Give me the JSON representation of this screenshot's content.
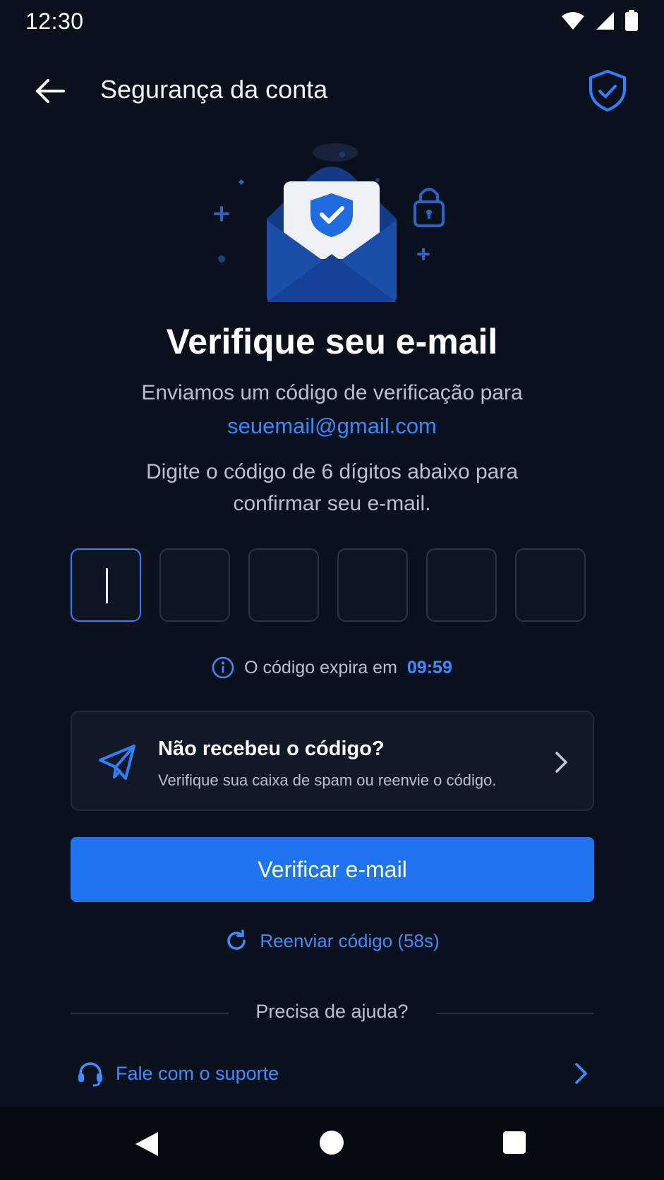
{
  "status_bar": {
    "time": "12:30"
  },
  "header": {
    "title": "Segurança da conta"
  },
  "content": {
    "title": "Verifique seu e-mail",
    "sent_text": "Enviamos um código de verificação para",
    "email": "seuemail@gmail.com",
    "instruction": "Digite o código de 6 dígitos abaixo para confirmar seu e-mail."
  },
  "otp": {
    "digits": [
      "",
      "",
      "",
      "",
      "",
      ""
    ],
    "active_index": 0
  },
  "expiry": {
    "label": "O código expira em",
    "timer": "09:59"
  },
  "help_card": {
    "title": "Não recebeu o código?",
    "subtitle": "Verifique sua caixa de spam ou reenvie o código."
  },
  "primary_button": {
    "label": "Verificar e-mail"
  },
  "resend": {
    "label": "Reenviar código (58s)"
  },
  "help": {
    "divider_label": "Precisa de ajuda?",
    "support_label": "Fale com o suporte"
  },
  "colors": {
    "accent": "#1f75f0",
    "link": "#3a8dff",
    "background": "#0b111c"
  },
  "icons": {
    "back": "arrow-left-icon",
    "shield": "shield-check-icon",
    "info": "info-icon",
    "send": "paper-plane-icon",
    "chevron": "chevron-right-icon",
    "refresh": "refresh-icon",
    "headset": "headset-icon"
  }
}
